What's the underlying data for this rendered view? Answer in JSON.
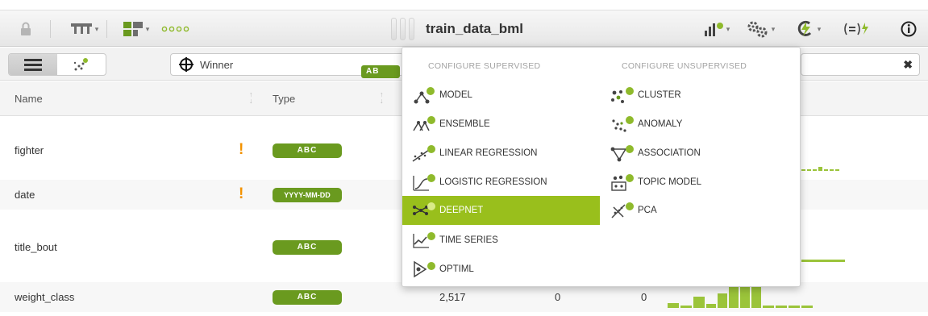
{
  "toolbar": {
    "title": "train_data_bml",
    "icons": [
      "lock-icon",
      "dataset-transform-icon",
      "filter-icon",
      "dots-icon",
      "chart-icon",
      "configure-icon",
      "one-click-icon",
      "formula-icon",
      "info-icon"
    ]
  },
  "row2": {
    "objective_label": "Winner",
    "objective_type": "AB"
  },
  "table": {
    "headers": {
      "name": "Name",
      "type": "Type"
    },
    "rows": [
      {
        "name": "fighter",
        "warn": "!",
        "type": "ABC"
      },
      {
        "name": "date",
        "warn": "!",
        "type": "YYYY-MM-DD"
      },
      {
        "name": "title_bout",
        "warn": "",
        "type": "ABC"
      },
      {
        "name": "weight_class",
        "warn": "",
        "type": "ABC",
        "count": "2,517",
        "missing": "0",
        "errors": "0"
      }
    ]
  },
  "menu": {
    "supervised_heading": "CONFIGURE SUPERVISED",
    "unsupervised_heading": "CONFIGURE UNSUPERVISED",
    "supervised": [
      "MODEL",
      "ENSEMBLE",
      "LINEAR REGRESSION",
      "LOGISTIC REGRESSION",
      "DEEPNET",
      "TIME SERIES",
      "OPTIML"
    ],
    "unsupervised": [
      "CLUSTER",
      "ANOMALY",
      "ASSOCIATION",
      "TOPIC MODEL",
      "PCA"
    ],
    "active_item": "DEEPNET"
  },
  "colors": {
    "accent": "#99bf1c",
    "badge": "#6a9a1f",
    "warning": "#f39200",
    "histogram": "#9bc43a"
  }
}
